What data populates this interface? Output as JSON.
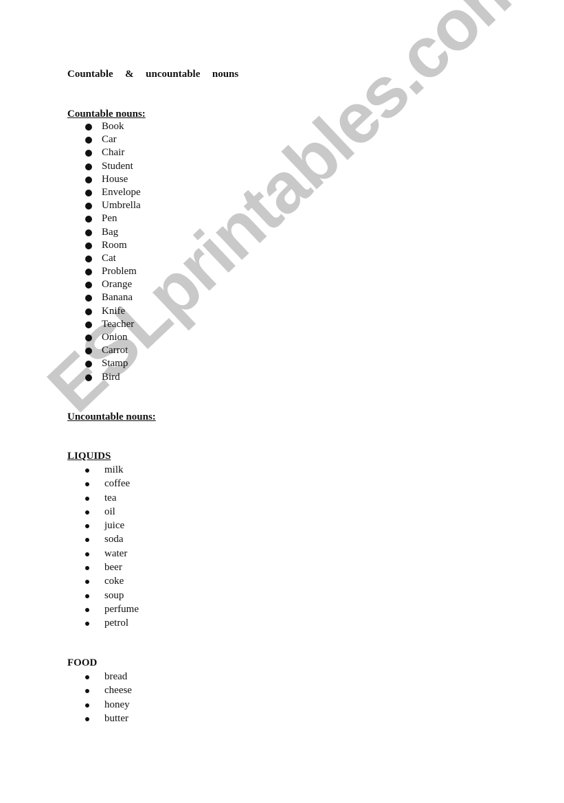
{
  "document": {
    "title": "Countable  &  uncountable  nouns",
    "watermark": "ESLprintables.com",
    "watermark_color": "#c9c9c9",
    "sections": {
      "countable": {
        "heading": "Countable nouns:",
        "items": [
          "Book",
          "Car",
          "Chair",
          "Student",
          "House",
          "Envelope",
          "Umbrella",
          "Pen",
          "Bag",
          "Room",
          "Cat",
          "Problem",
          "Orange",
          "Banana",
          "Knife",
          "Teacher",
          "Onion",
          "Carrot",
          "Stamp",
          "Bird"
        ]
      },
      "uncountable": {
        "heading": "Uncountable nouns:",
        "liquids": {
          "heading": "LIQUIDS",
          "items": [
            "milk",
            "coffee",
            "tea",
            "oil",
            "juice",
            "soda",
            "water",
            "beer",
            "coke",
            "soup",
            "perfume",
            "petrol"
          ]
        },
        "food": {
          "heading": "FOOD",
          "items": [
            "bread",
            "cheese",
            "honey",
            "butter"
          ]
        }
      }
    }
  }
}
